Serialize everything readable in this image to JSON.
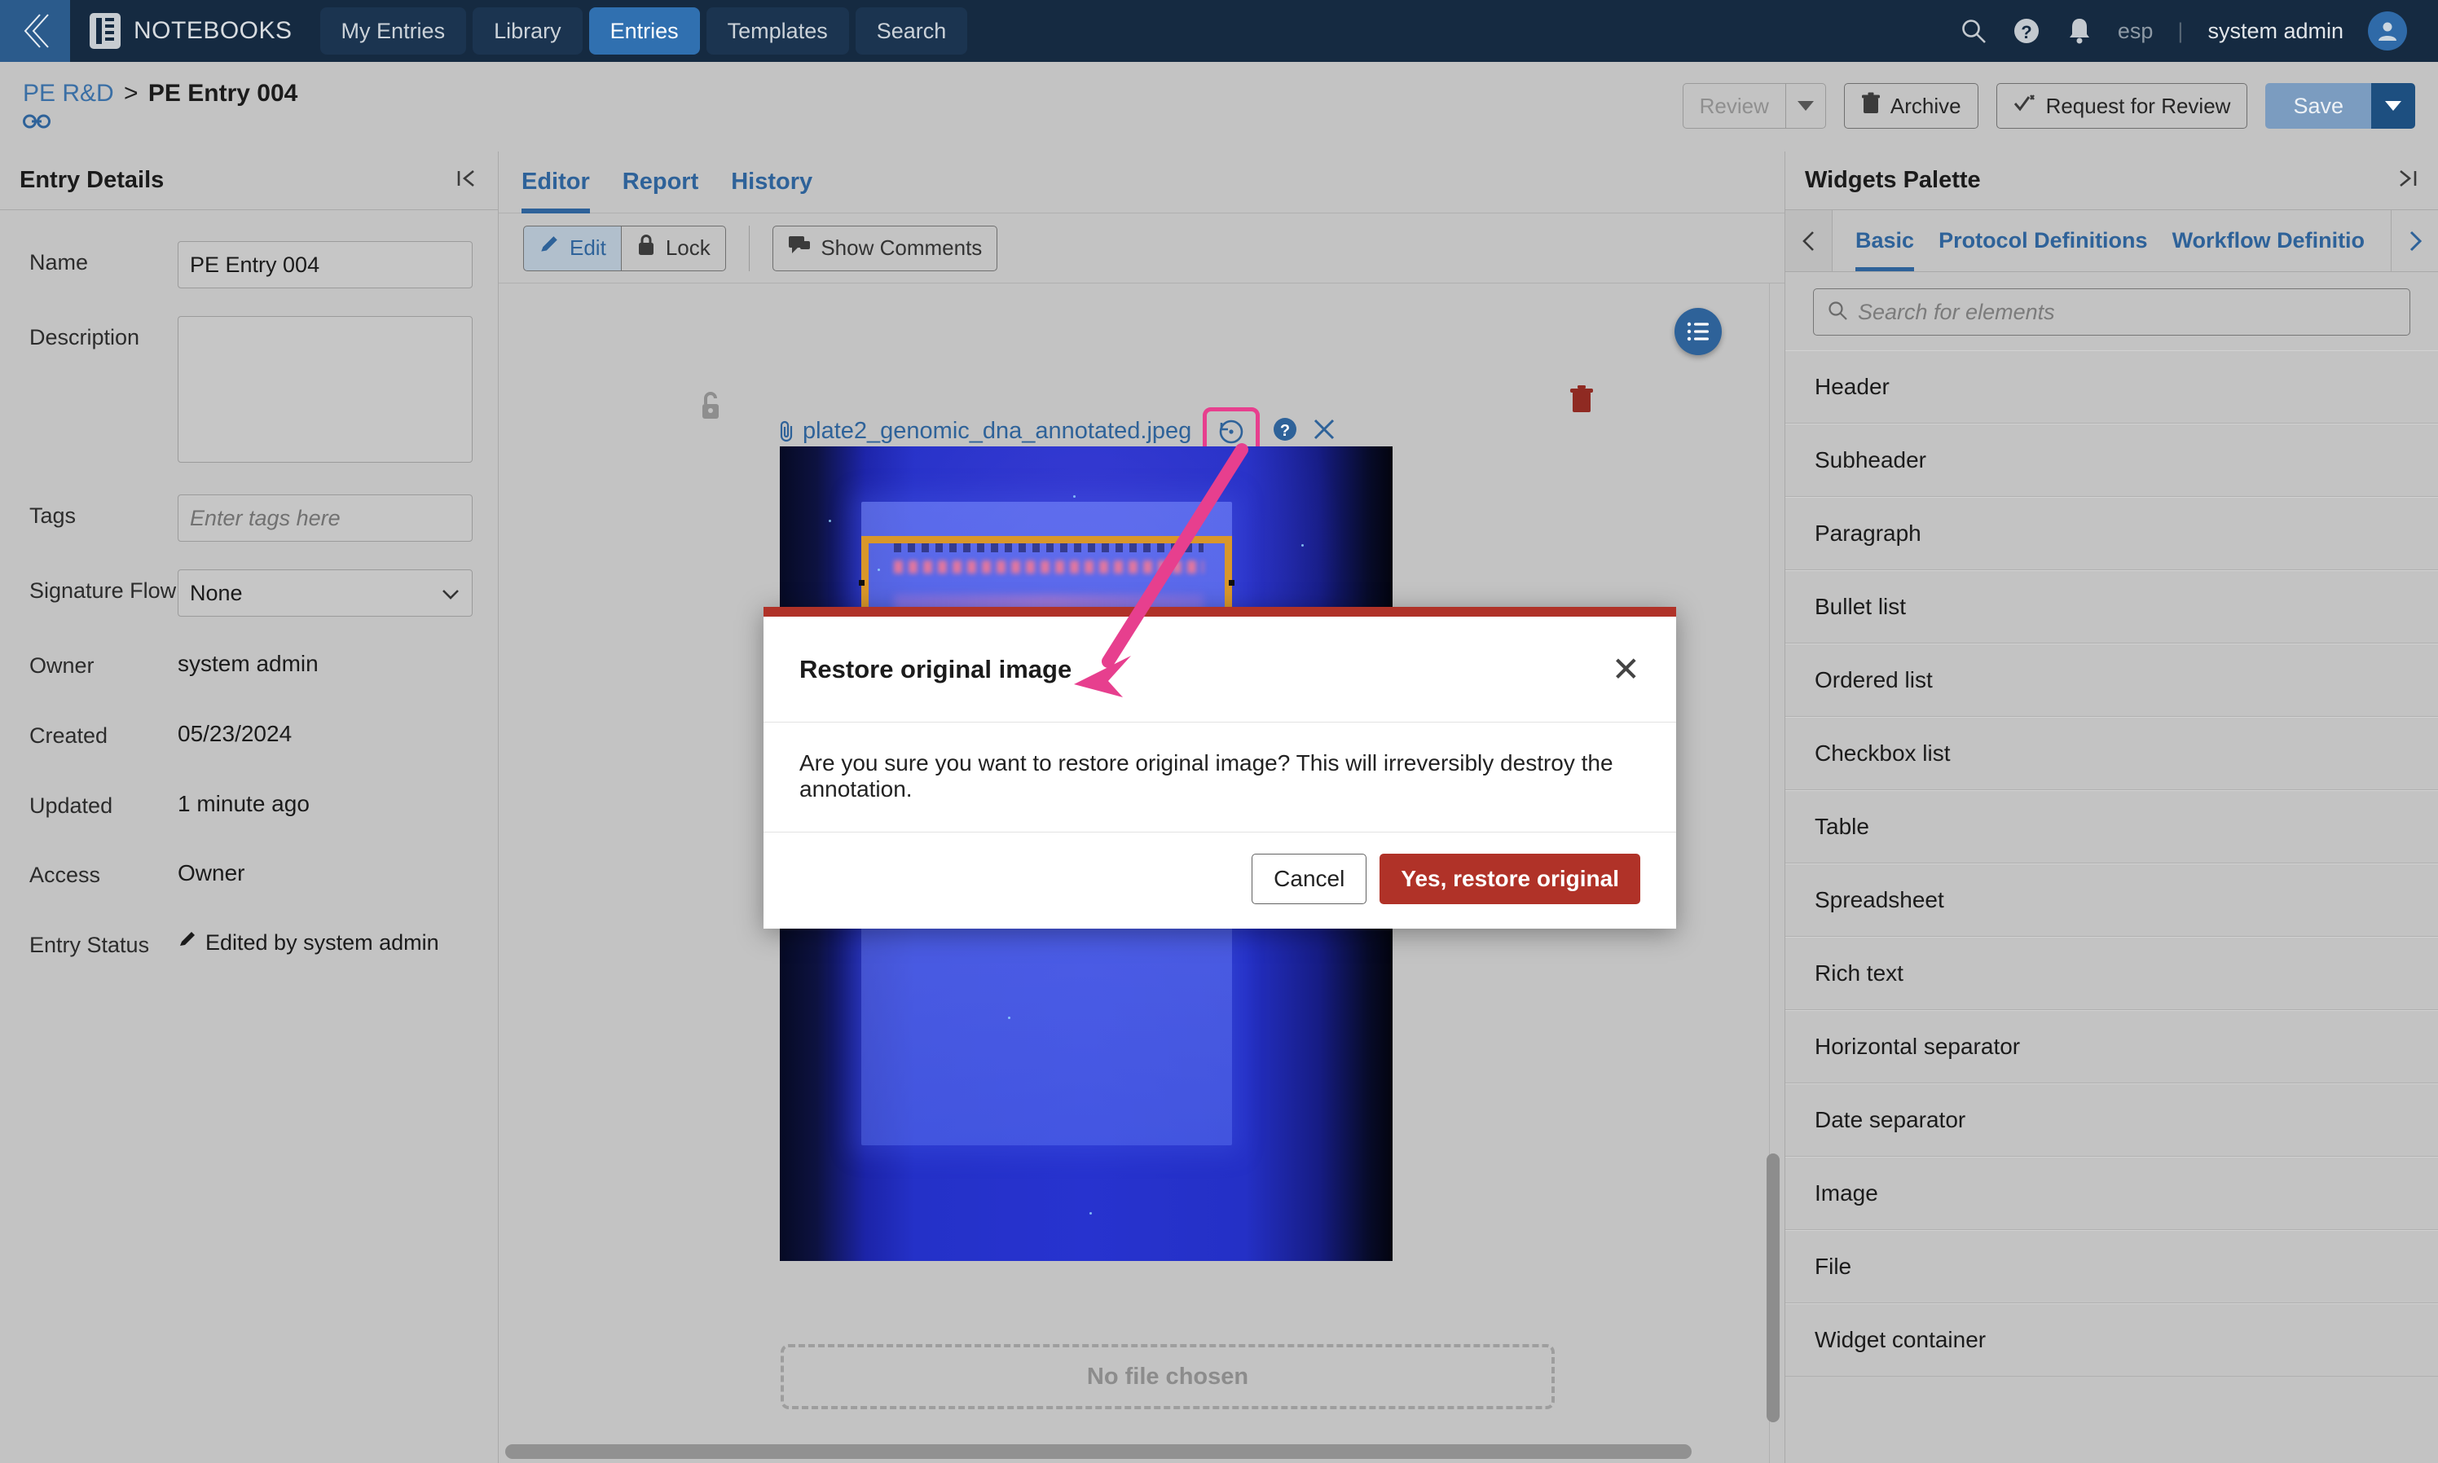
{
  "topnav": {
    "brand": "NOTEBOOKS",
    "tabs": [
      {
        "label": "My Entries",
        "active": false
      },
      {
        "label": "Library",
        "active": false
      },
      {
        "label": "Entries",
        "active": true
      },
      {
        "label": "Templates",
        "active": false
      },
      {
        "label": "Search",
        "active": false
      }
    ],
    "language": "esp",
    "separator": "|",
    "user": "system admin",
    "icons": [
      "search-icon",
      "help-icon",
      "notifications-bell-icon",
      "user-avatar-icon"
    ]
  },
  "breadcrumb": {
    "parent": "PE R&D",
    "separator": ">",
    "current": "PE Entry 004"
  },
  "actions": {
    "review": "Review",
    "archive": "Archive",
    "request_review": "Request for Review",
    "save": "Save"
  },
  "left_panel": {
    "title": "Entry Details",
    "fields": {
      "name_label": "Name",
      "name_value": "PE Entry 004",
      "description_label": "Description",
      "description_value": "",
      "tags_label": "Tags",
      "tags_placeholder": "Enter tags here",
      "signature_flow_label": "Signature Flow",
      "signature_flow_value": "None",
      "owner_label": "Owner",
      "owner_value": "system admin",
      "created_label": "Created",
      "created_value": "05/23/2024",
      "updated_label": "Updated",
      "updated_value": "1 minute ago",
      "access_label": "Access",
      "access_value": "Owner",
      "entry_status_label": "Entry Status",
      "entry_status_value": "Edited by system admin"
    }
  },
  "center": {
    "tabs": [
      {
        "label": "Editor",
        "active": true
      },
      {
        "label": "Report",
        "active": false
      },
      {
        "label": "History",
        "active": false
      }
    ],
    "toolbar": {
      "edit": "Edit",
      "lock": "Lock",
      "show_comments": "Show Comments"
    },
    "attachment": {
      "filename": "plate2_genomic_dna_annotated.jpeg",
      "restore_tooltip": "restore-original-icon",
      "help_tooltip": "help-icon",
      "remove_tooltip": "close-icon"
    },
    "dropzone": "No file chosen"
  },
  "right_panel": {
    "title": "Widgets Palette",
    "tabs": [
      {
        "label": "Basic",
        "active": true
      },
      {
        "label": "Protocol Definitions",
        "active": false
      },
      {
        "label": "Workflow Definitio",
        "active": false
      }
    ],
    "search_placeholder": "Search for elements",
    "widgets": [
      "Header",
      "Subheader",
      "Paragraph",
      "Bullet list",
      "Ordered list",
      "Checkbox list",
      "Table",
      "Spreadsheet",
      "Rich text",
      "Horizontal separator",
      "Date separator",
      "Image",
      "File",
      "Widget container"
    ]
  },
  "modal": {
    "title": "Restore original image",
    "message": "Are you sure you want to restore original image? This will irreversibly destroy the annotation.",
    "cancel": "Cancel",
    "confirm": "Yes, restore original",
    "close": "✕"
  },
  "colors": {
    "navbar": "#152a41",
    "nav_active_tab": "#3070b0",
    "page_bg": "#c3c3c3",
    "link_blue": "#2e6299",
    "danger_red": "#b03228",
    "annotation_pink": "#e73f8e",
    "annotation_orange": "#d9972a",
    "trash_red": "#8f2a22"
  }
}
